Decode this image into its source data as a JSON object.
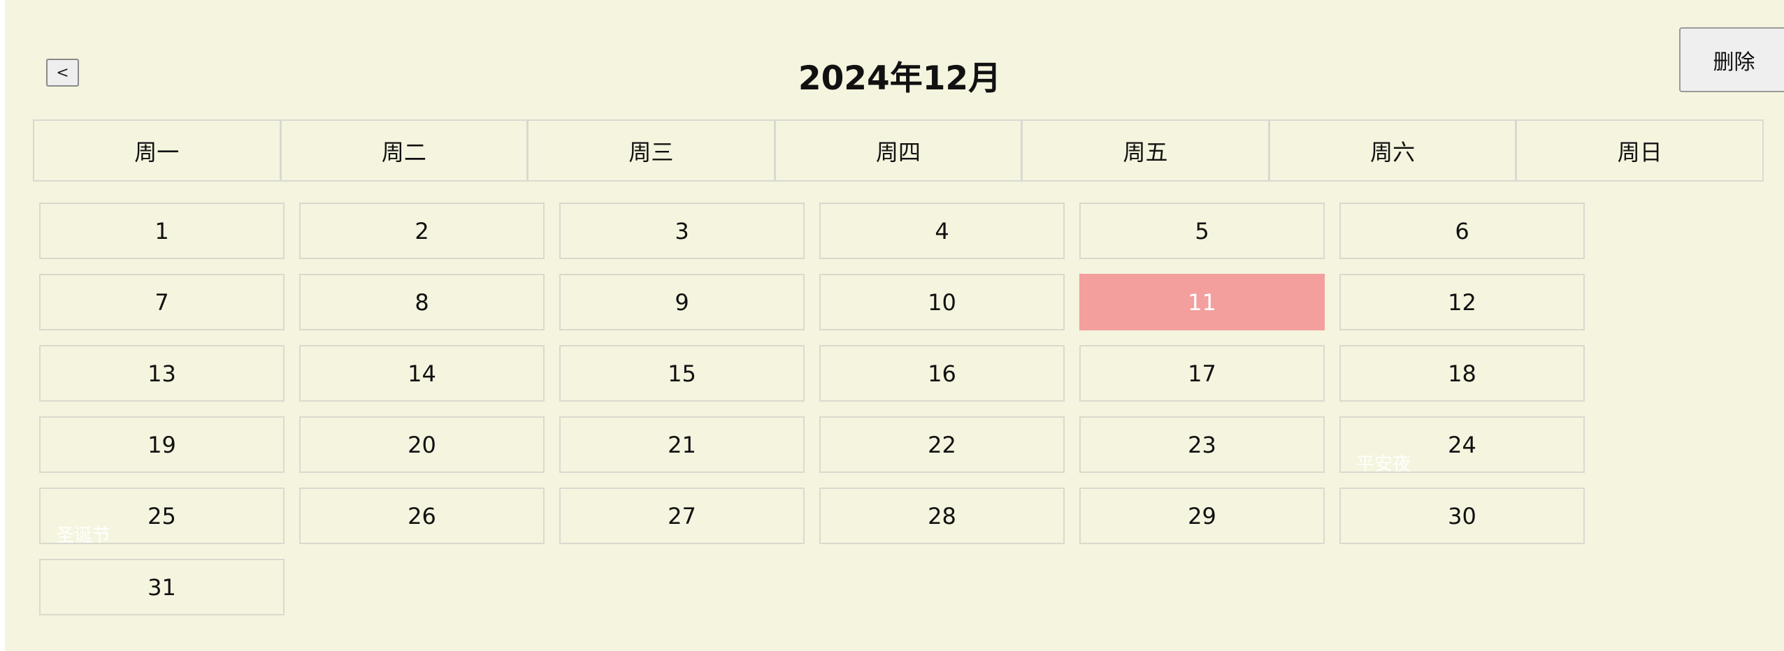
{
  "header": {
    "prev_label": "<",
    "title": "2024年12月",
    "delete_label": "删除"
  },
  "weekdays": [
    "周一",
    "周二",
    "周三",
    "周四",
    "周五",
    "周六",
    "周日"
  ],
  "days": [
    "1",
    "2",
    "3",
    "4",
    "5",
    "6",
    "7",
    "8",
    "9",
    "10",
    "11",
    "12",
    "13",
    "14",
    "15",
    "16",
    "17",
    "18",
    "19",
    "20",
    "21",
    "22",
    "23",
    "24",
    "25",
    "26",
    "27",
    "28",
    "29",
    "30",
    "31"
  ],
  "selected_day": "11",
  "holidays": {
    "day24": "平安夜",
    "day25": "圣诞节"
  },
  "colors": {
    "background": "#f5f4de",
    "selected": "#f29f9d"
  }
}
